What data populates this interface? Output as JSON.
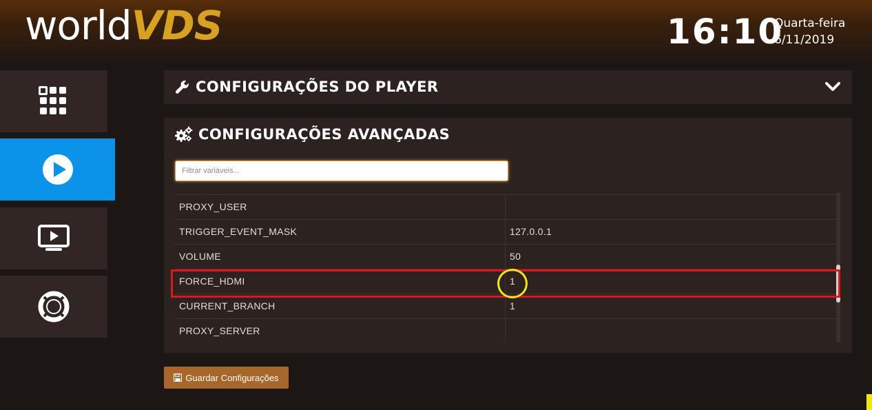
{
  "header": {
    "logo_part1": "world",
    "logo_part2": "VDS",
    "time": "16:10",
    "weekday": "Quarta-feira",
    "date": "6/11/2019"
  },
  "sidebar": {
    "items": [
      {
        "name": "apps",
        "icon": "grid-icon",
        "active": false
      },
      {
        "name": "player",
        "icon": "play-circle-icon",
        "active": true
      },
      {
        "name": "display",
        "icon": "monitor-play-icon",
        "active": false
      },
      {
        "name": "support",
        "icon": "lifebuoy-icon",
        "active": false
      }
    ]
  },
  "player_panel": {
    "title": "CONFIGURAÇÕES DO PLAYER",
    "icon": "wrench-icon",
    "toggle_icon": "chevron-down-icon"
  },
  "advanced_panel": {
    "title": "CONFIGURAÇÕES AVANÇADAS",
    "icon": "gears-icon",
    "filter_placeholder": "Filtrar variáveis...",
    "rows": [
      {
        "key": "PROXY_USER",
        "value": ""
      },
      {
        "key": "TRIGGER_EVENT_MASK",
        "value": "127.0.0.1"
      },
      {
        "key": "VOLUME",
        "value": "50"
      },
      {
        "key": "FORCE_HDMI",
        "value": "1"
      },
      {
        "key": "CURRENT_BRANCH",
        "value": "1"
      },
      {
        "key": "PROXY_SERVER",
        "value": ""
      }
    ]
  },
  "save_button": {
    "label": "Guardar Configurações",
    "icon": "floppy-disk-icon"
  },
  "colors": {
    "accent_blue": "#0a93e8",
    "logo_gold": "#d9a21e",
    "save_brown": "#a8672a",
    "highlight_red": "#e3141e",
    "highlight_yellow": "#f4e60e"
  }
}
